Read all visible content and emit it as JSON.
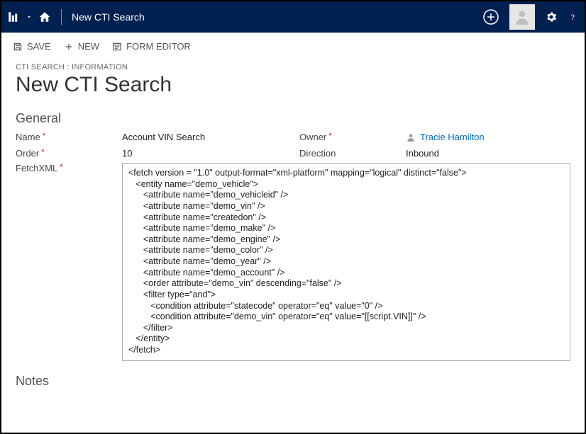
{
  "topbar": {
    "title": "New CTI Search"
  },
  "commands": {
    "save": "SAVE",
    "new": "NEW",
    "form_editor": "FORM EDITOR"
  },
  "breadcrumb": "CTI SEARCH : INFORMATION",
  "page_title": "New CTI Search",
  "sections": {
    "general": "General",
    "notes": "Notes"
  },
  "fields": {
    "name_label": "Name",
    "name_value": "Account VIN Search",
    "owner_label": "Owner",
    "owner_value": "Tracie Hamilton",
    "order_label": "Order",
    "order_value": "10",
    "direction_label": "Direction",
    "direction_value": "Inbound",
    "fetchxml_label": "FetchXML",
    "fetchxml_value": "<fetch version = \"1.0\" output-format=\"xml-platform\" mapping=\"logical\" distinct=\"false\">\n   <entity name=\"demo_vehicle\">\n      <attribute name=\"demo_vehicleid\" />\n      <attribute name=\"demo_vin\" />\n      <attribute name=\"createdon\" />\n      <attribute name=\"demo_make\" />\n      <attribute name=\"demo_engine\" />\n      <attribute name=\"demo_color\" />\n      <attribute name=\"demo_year\" />\n      <attribute name=\"demo_account\" />\n      <order attribute=\"demo_vin\" descending=\"false\" />\n      <filter type=\"and\">\n         <condition attribute=\"statecode\" operator=\"eq\" value=\"0\" />\n         <condition attribute=\"demo_vin\" operator=\"eq\" value=\"[[script.VIN]]\" />\n      </filter>\n   </entity>\n</fetch>"
  }
}
